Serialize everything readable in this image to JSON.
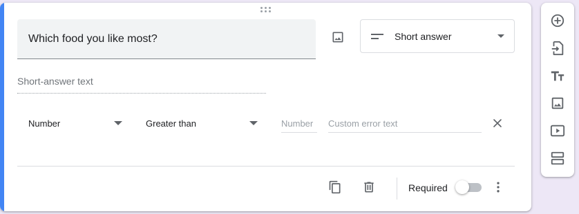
{
  "question": {
    "title": "Which food you like most?",
    "type_label": "Short answer",
    "answer_placeholder": "Short-answer text"
  },
  "validation": {
    "category": "Number",
    "condition": "Greater than",
    "value_placeholder": "Number",
    "error_placeholder": "Custom error text"
  },
  "footer": {
    "required_label": "Required",
    "required_on": false
  },
  "icons": {
    "drag": "drag-handle-icon",
    "add_image": "image-icon",
    "type": "short-text-icon",
    "clear": "close-icon",
    "duplicate": "copy-icon",
    "delete": "trash-icon",
    "more": "more-vert-icon"
  },
  "toolbar": {
    "items": [
      "add-question-icon",
      "import-questions-icon",
      "title-description-icon",
      "add-image-icon",
      "add-video-icon",
      "add-section-icon"
    ]
  },
  "colors": {
    "accent": "#4285f4",
    "background": "#ede7f6",
    "icon": "#5f6368"
  }
}
